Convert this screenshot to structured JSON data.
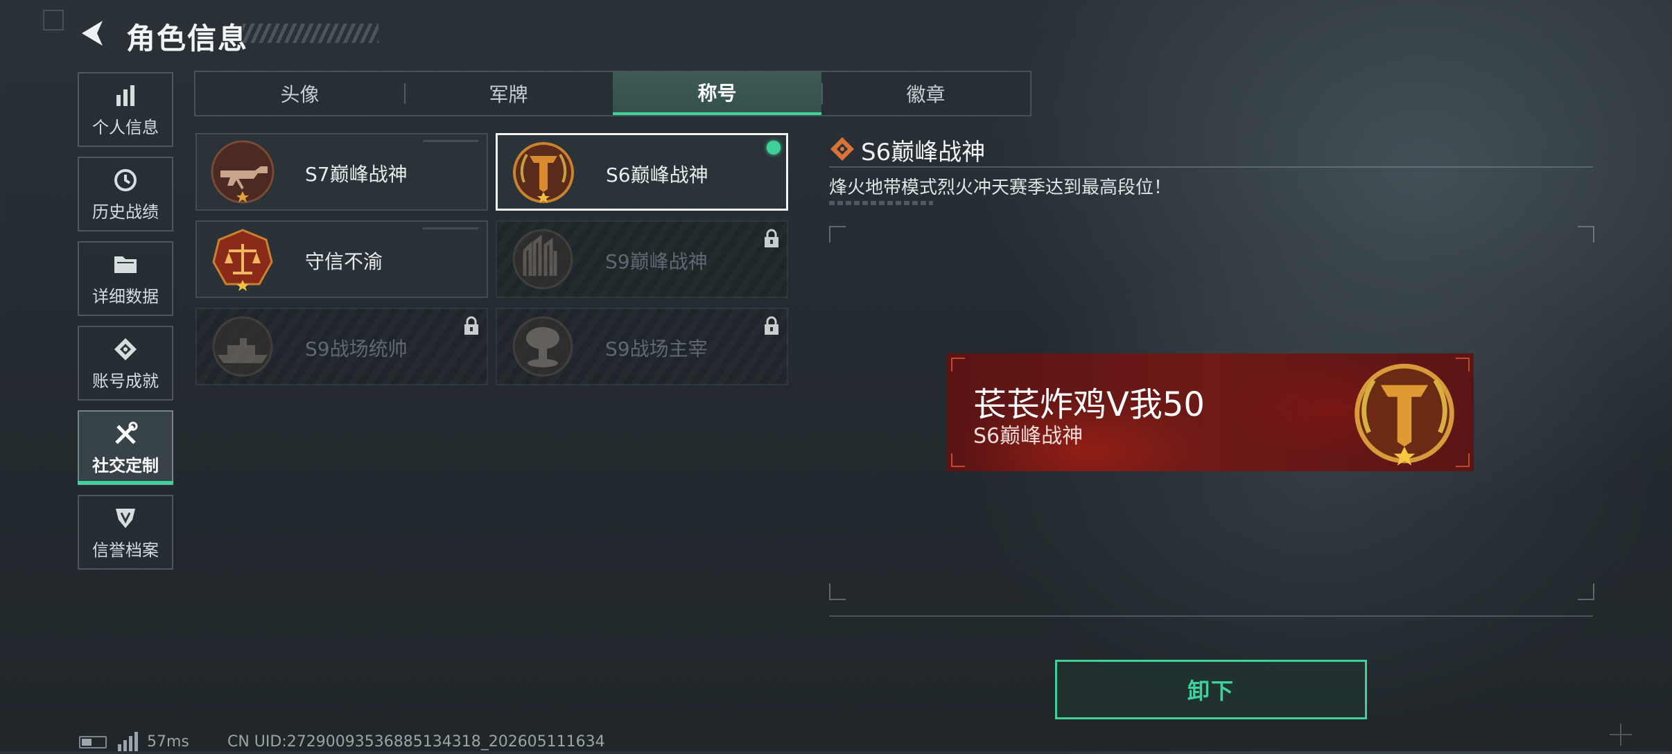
{
  "header": {
    "title": "角色信息"
  },
  "sidebar": {
    "items": [
      {
        "label": "个人信息",
        "icon": "bar-chart-icon"
      },
      {
        "label": "历史战绩",
        "icon": "history-clock-icon"
      },
      {
        "label": "详细数据",
        "icon": "folder-icon"
      },
      {
        "label": "账号成就",
        "icon": "achievement-icon"
      },
      {
        "label": "社交定制",
        "icon": "wrench-screwdriver-icon",
        "active": true
      },
      {
        "label": "信誉档案",
        "icon": "shield-icon"
      }
    ]
  },
  "tabs": [
    {
      "label": "头像"
    },
    {
      "label": "军牌"
    },
    {
      "label": "称号",
      "active": true
    },
    {
      "label": "徽章"
    }
  ],
  "titles": [
    {
      "name": "S7巅峰战神",
      "locked": false,
      "selected": false,
      "icon": "gun-medal-icon"
    },
    {
      "name": "S6巅峰战神",
      "locked": false,
      "selected": true,
      "equipped": true,
      "icon": "t-emblem-medal-icon"
    },
    {
      "name": "守信不渝",
      "locked": false,
      "selected": false,
      "icon": "scales-medal-icon"
    },
    {
      "name": "S9巅峰战神",
      "locked": true,
      "selected": false,
      "icon": "fortress-medal-icon"
    },
    {
      "name": "S9战场统帅",
      "locked": true,
      "selected": false,
      "icon": "warship-medal-icon"
    },
    {
      "name": "S9战场主宰",
      "locked": true,
      "selected": false,
      "icon": "mushroom-cloud-medal-icon"
    }
  ],
  "detail": {
    "title": "S6巅峰战神",
    "description": "烽火地带模式烈火冲天赛季达到最高段位！"
  },
  "preview": {
    "player_name": "苌苌炸鸡V我50",
    "title": "S6巅峰战神"
  },
  "actions": {
    "unequip_label": "卸下"
  },
  "status": {
    "ping": "57ms",
    "uid": "CN UID:27290093536885134318_202605111634"
  },
  "colors": {
    "accent": "#3ed29a",
    "banner_red": "#6e1a17",
    "medal_gold": "#c9822f"
  }
}
